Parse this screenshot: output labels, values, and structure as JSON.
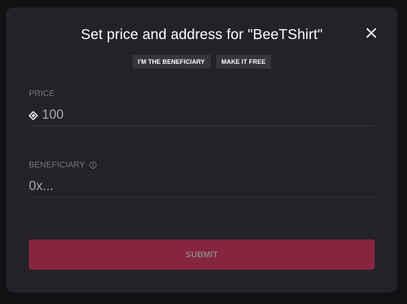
{
  "modal": {
    "title": "Set price and address for \"BeeTShirt\"",
    "close_icon": "close-icon"
  },
  "chips": {
    "beneficiary_label": "I'M THE BENEFICIARY",
    "free_label": "MAKE IT FREE"
  },
  "price": {
    "label": "PRICE",
    "value": "100",
    "icon": "mana-icon"
  },
  "beneficiary": {
    "label": "BENEFICIARY",
    "placeholder": "0x...",
    "icon": "info-icon"
  },
  "submit": {
    "label": "SUBMIT",
    "color": "#86253e"
  },
  "colors": {
    "modal_bg": "#242228",
    "backdrop": "#111113",
    "chip_bg": "#37353c"
  }
}
